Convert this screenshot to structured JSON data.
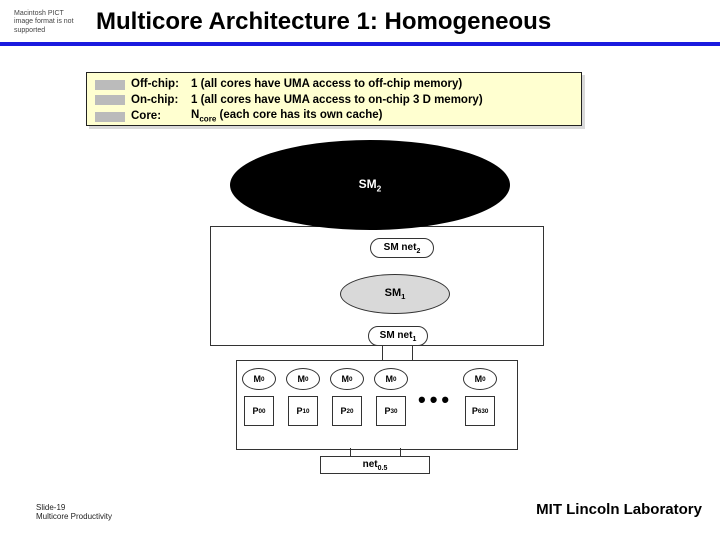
{
  "pict_placeholder": "Macintosh PICT image format is not supported",
  "title": "Multicore Architecture 1: Homogeneous",
  "info": {
    "rows": [
      {
        "label": "Off-chip:",
        "value": "1 (all cores have UMA access to off-chip memory)"
      },
      {
        "label": "On-chip:",
        "value": "1 (all cores have UMA access to on-chip 3 D memory)"
      },
      {
        "label": "Core:",
        "value_prefix": "N",
        "value_sub": "core",
        "value_suffix": " (each core has its own cache)"
      }
    ]
  },
  "diagram": {
    "sm2": "SM",
    "sm2_sub": "2",
    "smnet2": "SM net",
    "smnet2_sub": "2",
    "sm1": "SM",
    "sm1_sub": "1",
    "smnet1": "SM net",
    "smnet1_sub": "1",
    "net05": "net",
    "net05_sub": "0.5",
    "cores": [
      {
        "m": "M",
        "m_sub": "0",
        "p": "P",
        "p_sup": "0",
        "p_sub": "0"
      },
      {
        "m": "M",
        "m_sub": "0",
        "p": "P",
        "p_sup": "1",
        "p_sub": "0"
      },
      {
        "m": "M",
        "m_sub": "0",
        "p": "P",
        "p_sup": "2",
        "p_sub": "0"
      },
      {
        "m": "M",
        "m_sub": "0",
        "p": "P",
        "p_sup": "3",
        "p_sub": "0"
      }
    ],
    "last_core": {
      "m": "M",
      "m_sub": "0",
      "p": "P",
      "p_sup": "63",
      "p_sub": "0"
    },
    "ellipsis": "•••"
  },
  "footer": {
    "slide": "Slide-19",
    "deck": "Multicore Productivity",
    "org": "MIT Lincoln Laboratory"
  }
}
